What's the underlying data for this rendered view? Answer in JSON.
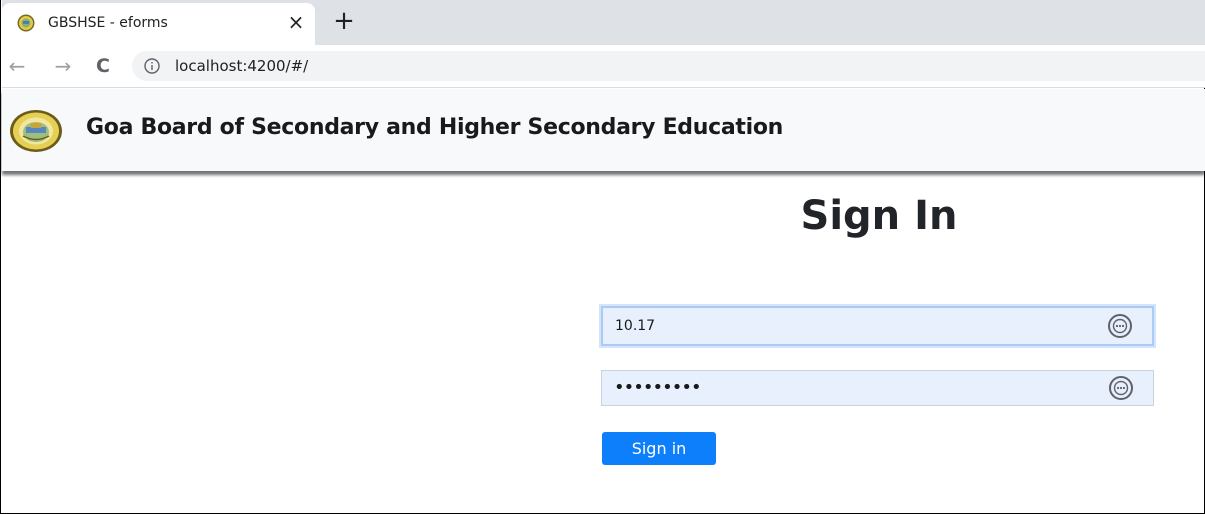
{
  "browser": {
    "tab_title": "GBSHSE - eforms",
    "tab_close": "×",
    "new_tab": "+",
    "nav": {
      "back": "←",
      "forward": "→",
      "reload": "C"
    },
    "url": "localhost:4200/#/"
  },
  "header": {
    "logo_icon": "gbshse-seal-icon",
    "title": "Goa Board of Secondary and Higher Secondary Education"
  },
  "signin": {
    "heading": "Sign In",
    "username_value": "10.17",
    "password_value": "•••••••••",
    "submit_label": "Sign in"
  },
  "icons": {
    "favicon": "gbshse-seal-icon",
    "info": "info-icon",
    "autofill": "password-manager-icon"
  },
  "colors": {
    "accent": "#0d7ffb",
    "autofill_bg": "#e8f0fe",
    "tabstrip": "#dee1e6"
  }
}
